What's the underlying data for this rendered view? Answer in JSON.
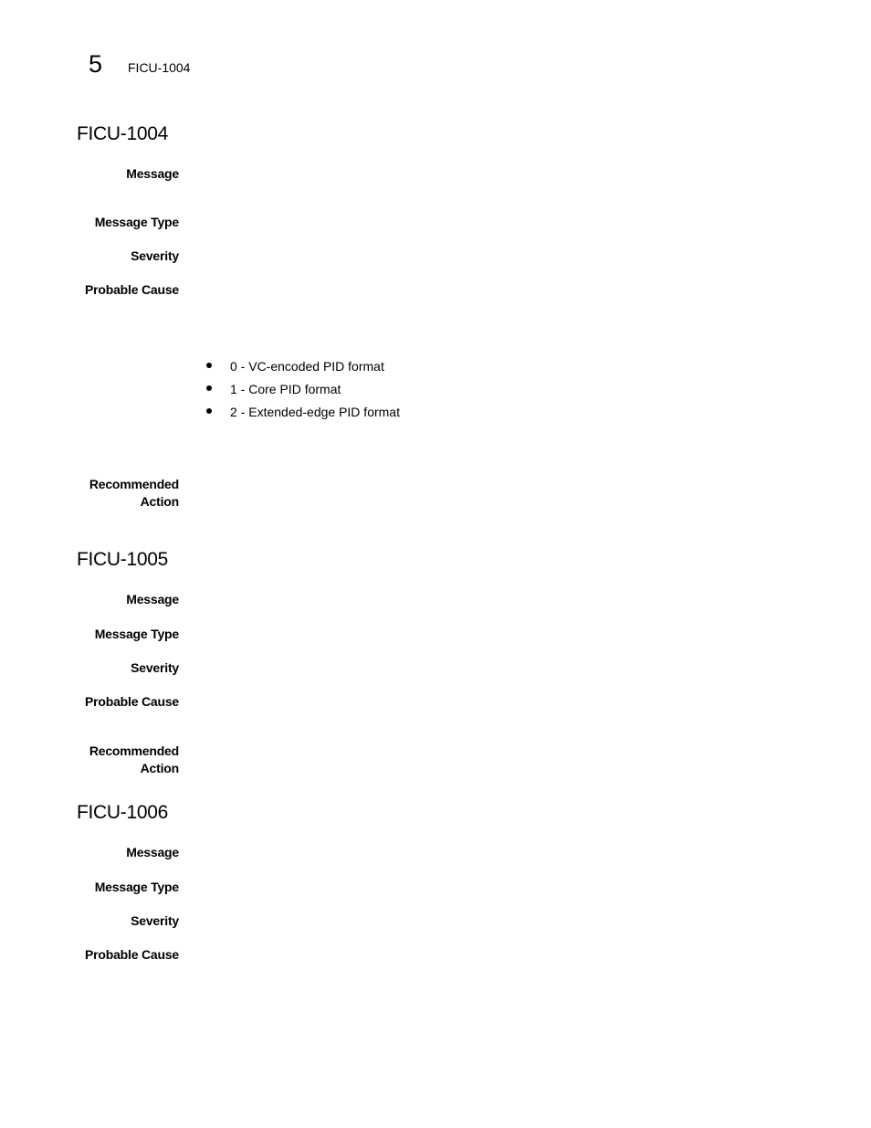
{
  "header": {
    "chapter_number": "5",
    "running_title": "FICU-1004"
  },
  "sections": [
    {
      "title": "FICU-1004",
      "labels": {
        "message": "Message",
        "message_type": "Message Type",
        "severity": "Severity",
        "probable_cause": "Probable Cause",
        "recommended_action_line1": "Recommended",
        "recommended_action_line2": "Action"
      },
      "probable_cause_list": [
        "0 - VC-encoded PID format",
        "1 - Core PID format",
        "2 - Extended-edge PID format"
      ]
    },
    {
      "title": "FICU-1005",
      "labels": {
        "message": "Message",
        "message_type": "Message Type",
        "severity": "Severity",
        "probable_cause": "Probable Cause",
        "recommended_action_line1": "Recommended",
        "recommended_action_line2": "Action"
      }
    },
    {
      "title": "FICU-1006",
      "labels": {
        "message": "Message",
        "message_type": "Message Type",
        "severity": "Severity",
        "probable_cause": "Probable Cause"
      }
    }
  ]
}
